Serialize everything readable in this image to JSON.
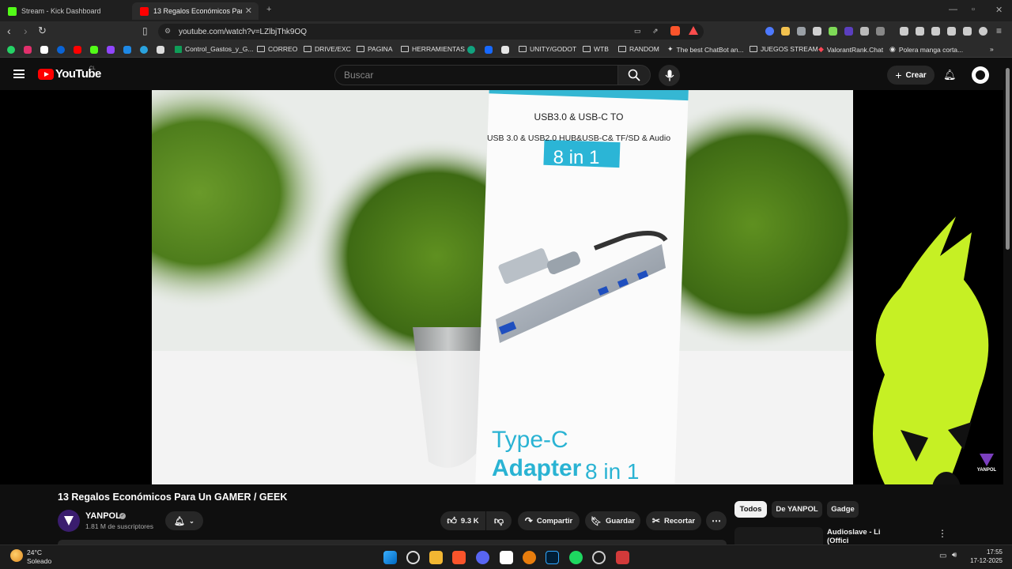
{
  "browser": {
    "tabs": [
      {
        "title": "Stream - Kick Dashboard",
        "active": false,
        "favicon_color": "#53fc18"
      },
      {
        "title": "13 Regalos Económicos Para Un",
        "active": true,
        "favicon_color": "#ff0000"
      }
    ],
    "url": "youtube.com/watch?v=LZlbjThk9OQ",
    "bookmarks": [
      {
        "label": "Control_Gastos_y_G...",
        "icon": "sheets-icon"
      },
      {
        "label": "CORREO",
        "icon": "folder-icon"
      },
      {
        "label": "DRIVE/EXC",
        "icon": "folder-icon"
      },
      {
        "label": "PAGINA",
        "icon": "folder-icon"
      },
      {
        "label": "HERRAMIENTAS",
        "icon": "folder-icon"
      },
      {
        "label": "UNITY/GODOT",
        "icon": "folder-icon"
      },
      {
        "label": "WTB",
        "icon": "folder-icon"
      },
      {
        "label": "RANDOM",
        "icon": "folder-icon"
      },
      {
        "label": "The best ChatBot an...",
        "icon": "openai-icon"
      },
      {
        "label": "JUEGOS STREAM",
        "icon": "folder-icon"
      },
      {
        "label": "ValorantRank.Chat",
        "icon": "valorant-icon"
      },
      {
        "label": "Polera manga corta...",
        "icon": "shop-icon"
      }
    ]
  },
  "youtube": {
    "logo_text": "YouTube",
    "region": "CL",
    "search_placeholder": "Buscar",
    "create_label": "Crear"
  },
  "video": {
    "title": "13 Regalos Económicos Para Un GAMER / GEEK",
    "box_text_1": "USB3.0 & USB-C TO",
    "box_text_2": "USB 3.0 & USB2.0 HUB&USB-C& TF/SD & Audio",
    "box_badge": "8 in 1",
    "box_type": "Type-C",
    "box_adapter": "Adapter",
    "box_adapter_suffix": "8 in 1",
    "watermark": "YANPOL"
  },
  "channel": {
    "name": "YANPOL",
    "subscribers": "1.81 M de suscriptores"
  },
  "actions": {
    "likes": "9.3 K",
    "share": "Compartir",
    "save": "Guardar",
    "clip": "Recortar"
  },
  "chips": [
    "Todos",
    "De YANPOL",
    "Gadge"
  ],
  "related": {
    "title_partial": "Audioslave - Li",
    "title_line2": "(Offici"
  },
  "taskbar": {
    "temperature": "24°C",
    "condition": "Soleado",
    "time": "17:55",
    "date": "17-12-2025"
  }
}
